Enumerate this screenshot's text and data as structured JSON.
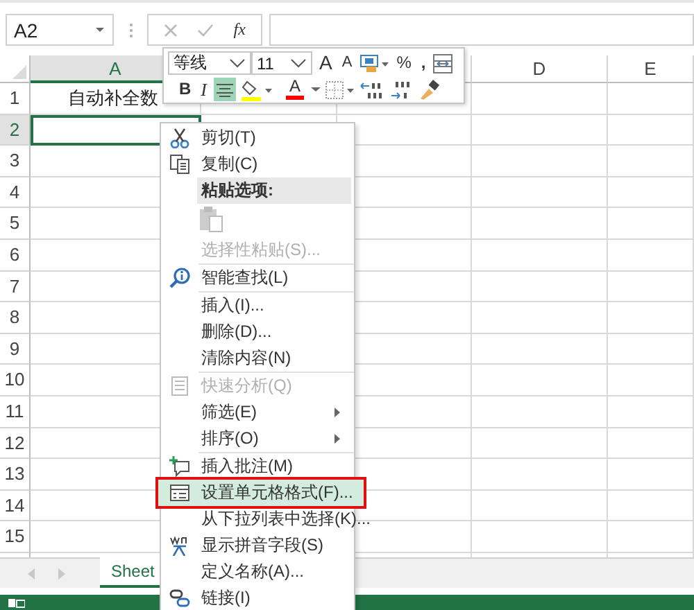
{
  "formula_bar": {
    "name_box": "A2",
    "function_label": "fx"
  },
  "columns": [
    {
      "label": "A",
      "selected": true
    },
    {
      "label": "D",
      "selected": false
    },
    {
      "label": "E",
      "selected": false
    }
  ],
  "rows": [
    {
      "number": "1",
      "selected": false,
      "cell_a": "自动补全数"
    },
    {
      "number": "2",
      "selected": true,
      "active_cell": true
    },
    {
      "number": "3",
      "selected": false
    },
    {
      "number": "4",
      "selected": false
    },
    {
      "number": "5",
      "selected": false
    },
    {
      "number": "6",
      "selected": false
    },
    {
      "number": "7",
      "selected": false
    },
    {
      "number": "8",
      "selected": false
    },
    {
      "number": "9",
      "selected": false
    },
    {
      "number": "10",
      "selected": false
    },
    {
      "number": "11",
      "selected": false
    },
    {
      "number": "12",
      "selected": false
    },
    {
      "number": "13",
      "selected": false
    },
    {
      "number": "14",
      "selected": false
    },
    {
      "number": "15",
      "selected": false
    }
  ],
  "mini_toolbar": {
    "font": "等线",
    "size": "11",
    "grow_font": "A",
    "shrink_font": "A",
    "percent": "%",
    "comma": ",",
    "bold": "B",
    "italic": "I",
    "font_color": "A",
    "center_align": {
      "selected": true
    }
  },
  "context_menu": [
    {
      "kind": "item",
      "label": "剪切(T)",
      "disabled": false,
      "selected": false
    },
    {
      "kind": "item",
      "label": "复制(C)",
      "disabled": false,
      "selected": false
    },
    {
      "kind": "header",
      "label": "粘贴选项:"
    },
    {
      "kind": "paste-icons",
      "disabled": true
    },
    {
      "kind": "item",
      "label": "选择性粘贴(S)...",
      "disabled": true,
      "selected": false,
      "separator_after": true
    },
    {
      "kind": "item",
      "label": "智能查找(L)",
      "disabled": false,
      "selected": false,
      "separator_after": true
    },
    {
      "kind": "item",
      "label": "插入(I)...",
      "disabled": false,
      "selected": false
    },
    {
      "kind": "item",
      "label": "删除(D)...",
      "disabled": false,
      "selected": false
    },
    {
      "kind": "item",
      "label": "清除内容(N)",
      "disabled": false,
      "selected": false,
      "separator_after": true
    },
    {
      "kind": "item",
      "label": "快速分析(Q)",
      "disabled": true,
      "selected": false
    },
    {
      "kind": "item",
      "label": "筛选(E)",
      "disabled": false,
      "selected": false,
      "submenu": true
    },
    {
      "kind": "item",
      "label": "排序(O)",
      "disabled": false,
      "selected": false,
      "submenu": true,
      "separator_after": true
    },
    {
      "kind": "item",
      "label": "插入批注(M)",
      "disabled": false,
      "selected": false
    },
    {
      "kind": "item",
      "label": "设置单元格格式(F)...",
      "disabled": false,
      "selected": true,
      "annotated": true
    },
    {
      "kind": "item",
      "label": "从下拉列表中选择(K)...",
      "disabled": false,
      "selected": false
    },
    {
      "kind": "item",
      "label": "显示拼音字段(S)",
      "disabled": false,
      "selected": false
    },
    {
      "kind": "item",
      "label": "定义名称(A)...",
      "disabled": false,
      "selected": false
    },
    {
      "kind": "item",
      "label": "链接(I)",
      "disabled": false,
      "selected": false
    }
  ],
  "sheet_tabs": [
    {
      "label": "Sheet",
      "selected": true
    }
  ]
}
